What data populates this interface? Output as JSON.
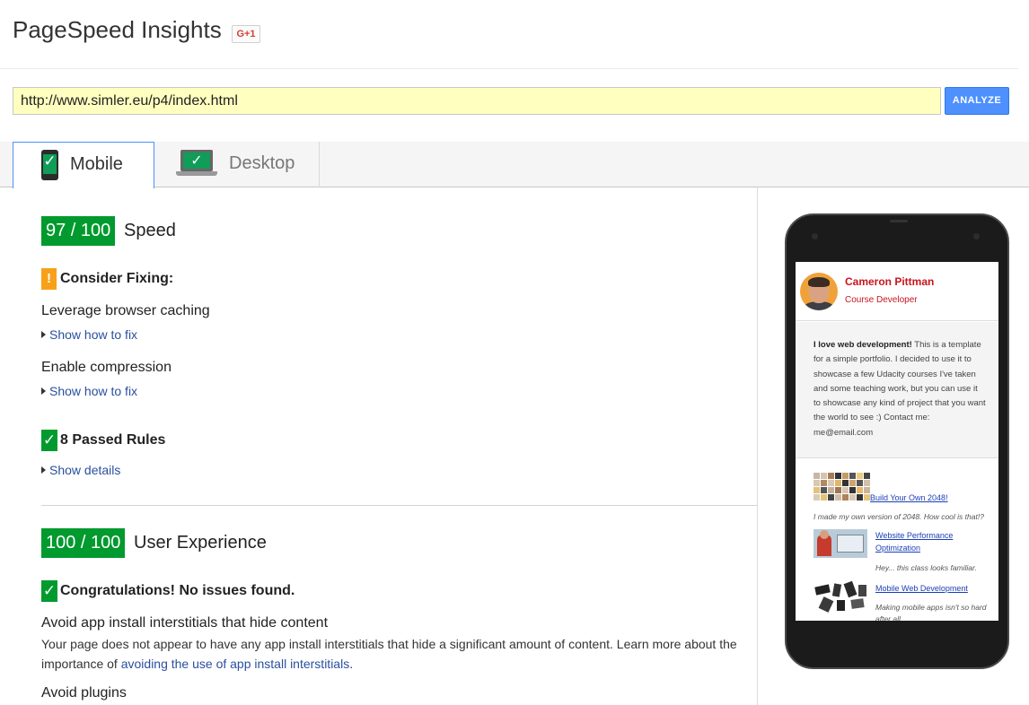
{
  "header": {
    "title": "PageSpeed Insights",
    "gplus_label": "G+1"
  },
  "search": {
    "url": "http://www.simler.eu/p4/index.html",
    "analyze_label": "ANALYZE"
  },
  "tabs": [
    {
      "label": "Mobile",
      "icon": "phone-icon",
      "selected": true
    },
    {
      "label": "Desktop",
      "icon": "laptop-icon",
      "selected": false
    }
  ],
  "speed": {
    "score": "97 / 100",
    "label": "Speed",
    "consider_heading": "Consider Fixing:",
    "rules": [
      {
        "name": "Leverage browser caching",
        "link": "Show how to fix"
      },
      {
        "name": "Enable compression",
        "link": "Show how to fix"
      }
    ],
    "passed_heading": "8 Passed Rules",
    "passed_link": "Show details"
  },
  "ux": {
    "score": "100 / 100",
    "label": "User Experience",
    "congrats": "Congratulations! No issues found.",
    "rule1_name": "Avoid app install interstitials that hide content",
    "rule1_desc": "Your page does not appear to have any app install interstitials that hide a significant amount of content. Learn more about the importance of",
    "rule1_link": "avoiding the use of app install interstitials",
    "rule1_end": ".",
    "rule2_name": "Avoid plugins"
  },
  "preview": {
    "name": "Cameron Pittman",
    "role": "Course Developer",
    "bio_bold": "I love web development!",
    "bio_rest": " This is a template for a simple portfolio. I decided to use it to showcase a few Udacity courses I've taken and some teaching work, but you can use it to showcase any kind of project that you want the world to see :) Contact me: me@email.com",
    "projects": [
      {
        "title": "Build Your Own 2048!",
        "caption": "I made my own version of 2048. How cool is that!?"
      },
      {
        "title": "Website Performance Optimization",
        "caption": "Hey... this class looks familiar."
      },
      {
        "title": "Mobile Web Development",
        "caption": "Making mobile apps isn't so hard after all."
      }
    ]
  },
  "colors": {
    "score_green": "#009a2e",
    "warning_orange": "#f7a11a",
    "link_blue": "#2a4f9e",
    "analyze_blue": "#4d90fe",
    "url_bg": "#ffffc0",
    "preview_red": "#c9141e"
  }
}
